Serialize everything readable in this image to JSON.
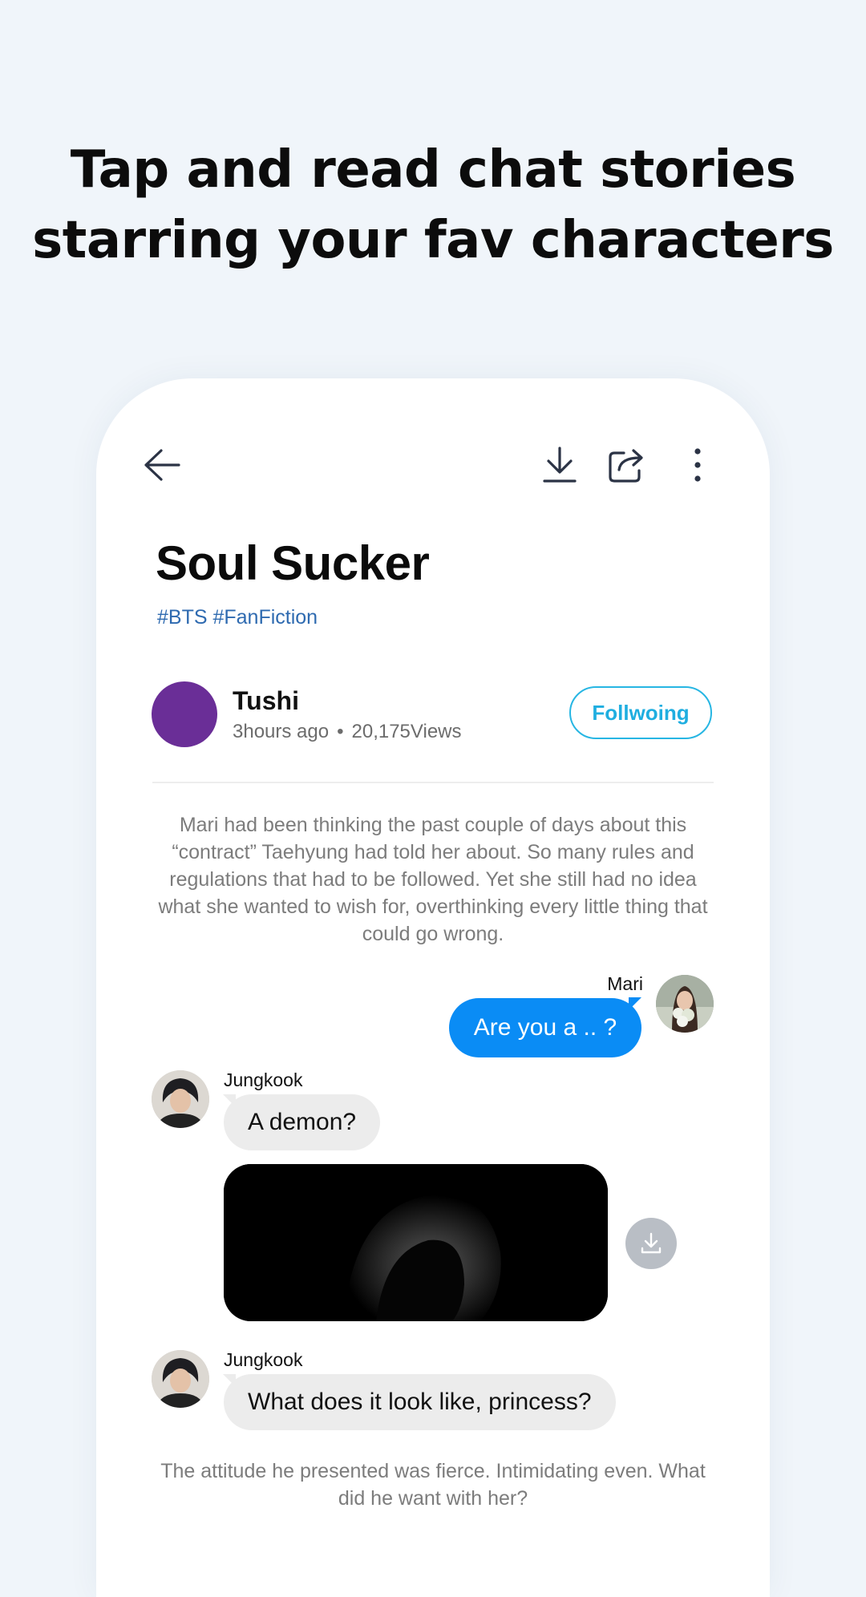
{
  "headline": {
    "line1": "Tap and read chat stories",
    "line2": "starring your fav characters"
  },
  "toolbar": {
    "back_icon": "arrow-left-icon",
    "download_icon": "download-icon",
    "share_icon": "share-icon",
    "more_icon": "more-vertical-icon"
  },
  "story": {
    "title": "Soul Sucker",
    "tags": "#BTS #FanFiction"
  },
  "author": {
    "name": "Tushi",
    "time": "3hours ago",
    "separator": "•",
    "views": "20,175Views",
    "follow_label": "Follwoing",
    "avatar_color": "#6a2e97"
  },
  "chat": {
    "narration_1": "Mari had been thinking the past couple of days about this “contract” Taehyung had told her about. So many rules and regulations that had to be followed. Yet she still had no idea what she wanted to wish for, overthinking every little thing that could go wrong.",
    "messages": [
      {
        "sender": "Mari",
        "text": "Are you a .. ?"
      },
      {
        "sender": "Jungkook",
        "text": "A demon?"
      },
      {
        "sender": "Jungkook",
        "text": "What does it look like, princess?"
      }
    ],
    "narration_2": "The attitude he presented was fierce. Intimidating even. What did he want with her?"
  },
  "colors": {
    "background": "#f0f5fa",
    "accent": "#0a8cf5",
    "follow": "#1faee0",
    "tag": "#2e6ab0"
  }
}
